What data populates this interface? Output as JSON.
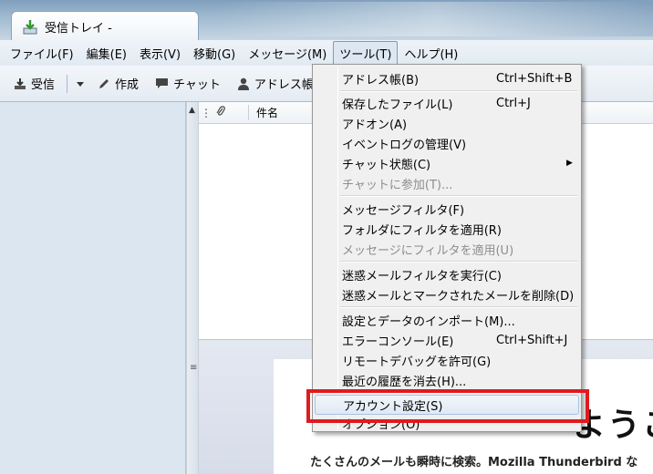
{
  "window": {
    "tab_label": "受信トレイ -"
  },
  "menubar": [
    {
      "label": "ファイル(F)",
      "active": false
    },
    {
      "label": "編集(E)",
      "active": false
    },
    {
      "label": "表示(V)",
      "active": false
    },
    {
      "label": "移動(G)",
      "active": false
    },
    {
      "label": "メッセージ(M)",
      "active": false
    },
    {
      "label": "ツール(T)",
      "active": true
    },
    {
      "label": "ヘルプ(H)",
      "active": false
    }
  ],
  "toolbar": {
    "get_mail": "受信",
    "write": "作成",
    "chat": "チャット",
    "address_book": "アドレス帳"
  },
  "thread_header": {
    "subject": "件名"
  },
  "tools_menu": {
    "items": [
      {
        "label": "アドレス帳(B)",
        "shortcut": "Ctrl+Shift+B",
        "disabled": false
      },
      {
        "label": "保存したファイル(L)",
        "shortcut": "Ctrl+J",
        "disabled": false
      },
      {
        "label": "アドオン(A)",
        "shortcut": "",
        "disabled": false
      },
      {
        "label": "イベントログの管理(V)",
        "shortcut": "",
        "disabled": false
      },
      {
        "label": "チャット状態(C)",
        "shortcut": "",
        "disabled": false,
        "submenu": true
      },
      {
        "label": "チャットに参加(T)...",
        "shortcut": "",
        "disabled": true
      },
      {
        "label": "メッセージフィルタ(F)",
        "shortcut": "",
        "disabled": false
      },
      {
        "label": "フォルダにフィルタを適用(R)",
        "shortcut": "",
        "disabled": false
      },
      {
        "label": "メッセージにフィルタを適用(U)",
        "shortcut": "",
        "disabled": true
      },
      {
        "label": "迷惑メールフィルタを実行(C)",
        "shortcut": "",
        "disabled": false
      },
      {
        "label": "迷惑メールとマークされたメールを削除(D)",
        "shortcut": "",
        "disabled": false
      },
      {
        "label": "設定とデータのインポート(M)...",
        "shortcut": "",
        "disabled": false
      },
      {
        "label": "エラーコンソール(E)",
        "shortcut": "Ctrl+Shift+J",
        "disabled": false
      },
      {
        "label": "リモートデバッグを許可(G)",
        "shortcut": "",
        "disabled": false
      },
      {
        "label": "最近の履歴を消去(H)...",
        "shortcut": "",
        "disabled": false
      },
      {
        "label": "アカウント設定(S)",
        "shortcut": "",
        "disabled": false,
        "highlighted": true
      },
      {
        "label": "オプション(O)",
        "shortcut": "",
        "disabled": false
      }
    ]
  },
  "start_page": {
    "title": "ようこ",
    "text": "たくさんのメールも瞬時に検索。Mozilla Thunderbird な"
  },
  "colors": {
    "highlight_box": "#e01a1f",
    "menu_bg": "#f0f0f0",
    "folder_pane": "#dbe6f1"
  }
}
